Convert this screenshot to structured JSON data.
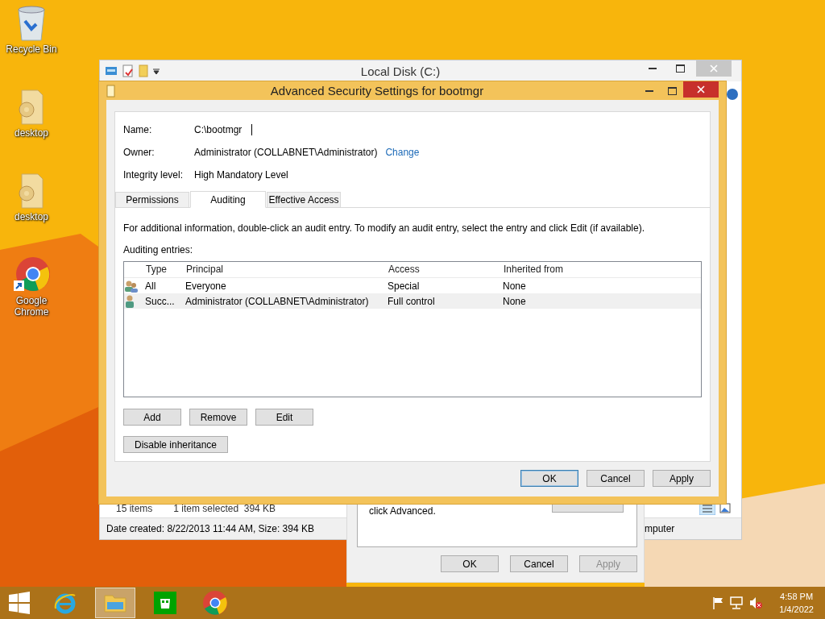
{
  "desktop_icons": [
    {
      "label": "Recycle Bin",
      "kind": "recycle"
    },
    {
      "label": "desktop",
      "kind": "file"
    },
    {
      "label": "desktop",
      "kind": "file"
    },
    {
      "label": "Google Chrome",
      "kind": "chrome"
    }
  ],
  "explorer": {
    "title": "Local Disk (C:)",
    "item_count": "15 items",
    "selection": "1 item selected  394 KB",
    "details": "Date created: 8/22/2013 11:44 AM, Size: 394 KB",
    "details_right": "mputer"
  },
  "properties_dialog": {
    "text": "click Advanced.",
    "buttons": [
      {
        "label": "OK",
        "disabled": false
      },
      {
        "label": "Cancel",
        "disabled": false
      },
      {
        "label": "Apply",
        "disabled": true
      }
    ]
  },
  "dialog": {
    "title": "Advanced Security Settings for bootmgr",
    "fields": [
      {
        "label": "Name:",
        "value": "C:\\bootmgr",
        "kind": "input"
      },
      {
        "label": "Owner:",
        "value": "Administrator (COLLABNET\\Administrator)",
        "link": "Change",
        "kind": "link"
      },
      {
        "label": "Integrity level:",
        "value": "High Mandatory Level",
        "kind": "text"
      }
    ],
    "tabs": [
      {
        "label": "Permissions",
        "selected": false
      },
      {
        "label": "Auditing",
        "selected": true
      },
      {
        "label": "Effective Access",
        "selected": false
      }
    ],
    "info": "For additional information, double-click an audit entry. To modify an audit entry, select the entry and click Edit (if available).",
    "list_label": "Auditing entries:",
    "columns": [
      "Type",
      "Principal",
      "Access",
      "Inherited from"
    ],
    "rows": [
      {
        "kind": "group",
        "type": "All",
        "principal": "Everyone",
        "access": "Special",
        "inherited": "None",
        "selected": false
      },
      {
        "kind": "user",
        "type": "Succ...",
        "principal": "Administrator (COLLABNET\\Administrator)",
        "access": "Full control",
        "inherited": "None",
        "selected": true
      }
    ],
    "entry_buttons": [
      "Add",
      "Remove",
      "Edit"
    ],
    "inheritance_button": "Disable inheritance",
    "buttons": [
      {
        "label": "OK",
        "default": true
      },
      {
        "label": "Cancel",
        "default": false
      },
      {
        "label": "Apply",
        "default": false
      }
    ]
  },
  "taskbar": {
    "apps": [
      {
        "kind": "ie",
        "active": false
      },
      {
        "kind": "explorer",
        "active": true
      },
      {
        "kind": "store",
        "active": false
      },
      {
        "kind": "chrome",
        "active": false
      }
    ],
    "time": "4:58 PM",
    "date": "1/4/2022"
  }
}
